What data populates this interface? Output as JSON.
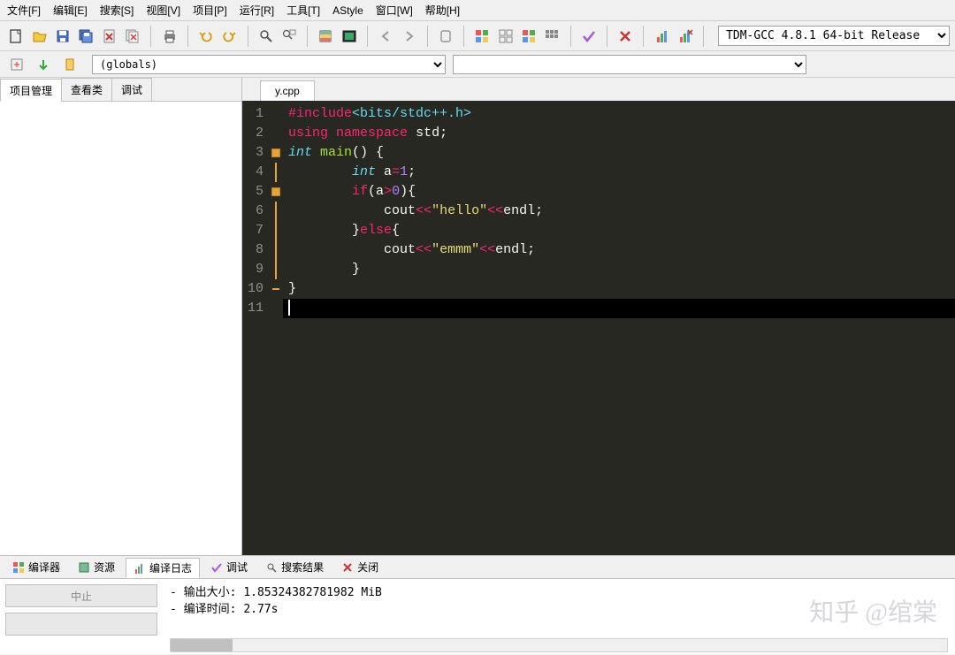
{
  "menu": {
    "file": "文件[F]",
    "edit": "编辑[E]",
    "search": "搜索[S]",
    "view": "视图[V]",
    "project": "项目[P]",
    "run": "运行[R]",
    "tools": "工具[T]",
    "astyle": "AStyle",
    "window": "窗口[W]",
    "help": "帮助[H]"
  },
  "compiler_selected": "TDM-GCC 4.8.1 64-bit Release",
  "scope_selected": "(globals)",
  "side_tabs": {
    "project": "项目管理",
    "classes": "查看类",
    "debug": "调试"
  },
  "file_tab": "y.cpp",
  "code": {
    "lines": [
      "1",
      "2",
      "3",
      "4",
      "5",
      "6",
      "7",
      "8",
      "9",
      "10",
      "11"
    ],
    "l1_include": "#include",
    "l1_header": "<bits/stdc++.h>",
    "l2_using": "using",
    "l2_namespace": "namespace",
    "l2_std": "std",
    "l3_int": "int",
    "l3_main": "main",
    "l4_int": "int",
    "l4_a": "a",
    "l4_eq": "=",
    "l4_1": "1",
    "l5_if": "if",
    "l5_a": "a",
    "l5_gt": ">",
    "l5_0": "0",
    "l6_cout": "cout",
    "l6_str": "\"hello\"",
    "l6_endl": "endl",
    "l7_else": "else",
    "l8_cout": "cout",
    "l8_str": "\"emmm\"",
    "l8_endl": "endl"
  },
  "bottom_tabs": {
    "compiler": "编译器",
    "resources": "资源",
    "log": "编译日志",
    "debug": "调试",
    "results": "搜索结果",
    "close": "关闭"
  },
  "bp_buttons": {
    "abort": "中止",
    "blank": ""
  },
  "output": {
    "size_label": "- 输出大小: ",
    "size_value": "1.85324382781982 MiB",
    "time_label": "- 编译时间: ",
    "time_value": "2.77s"
  },
  "watermark": "知乎 @绾棠"
}
